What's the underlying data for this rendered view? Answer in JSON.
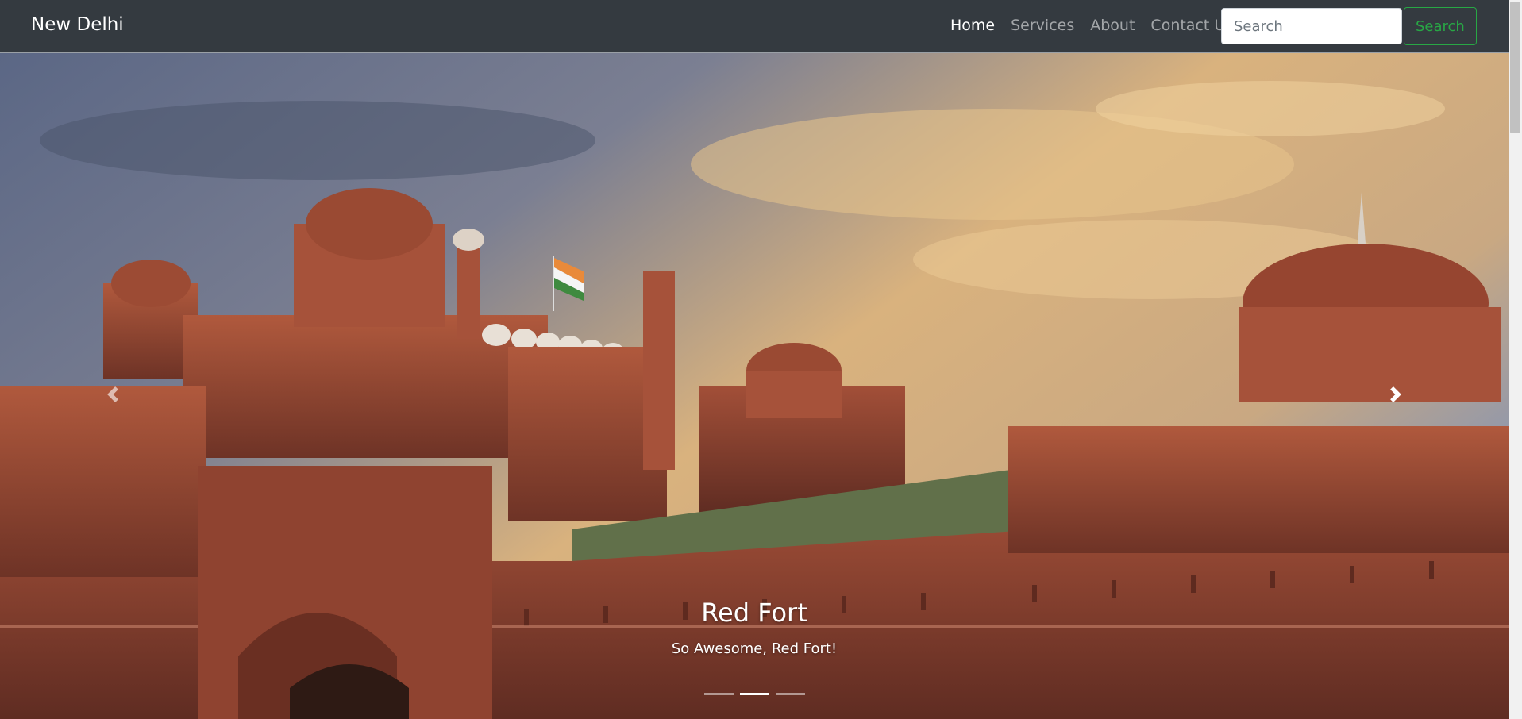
{
  "navbar": {
    "brand": "New Delhi",
    "links": [
      {
        "label": "Home",
        "active": true
      },
      {
        "label": "Services",
        "active": false
      },
      {
        "label": "About",
        "active": false
      },
      {
        "label": "Contact Us",
        "active": false
      }
    ],
    "search": {
      "placeholder": "Search",
      "value": "",
      "button_label": "Search"
    }
  },
  "carousel": {
    "caption_title": "Red Fort",
    "caption_text": "So Awesome, Red Fort!",
    "slide_count": 3,
    "active_slide": 2,
    "prev_icon": "chevron-left-icon",
    "next_icon": "chevron-right-icon"
  },
  "colors": {
    "navbar_bg": "#343a40",
    "search_button": "#28a745",
    "link_active": "#ffffff",
    "link_inactive": "rgba(255,255,255,0.55)"
  }
}
